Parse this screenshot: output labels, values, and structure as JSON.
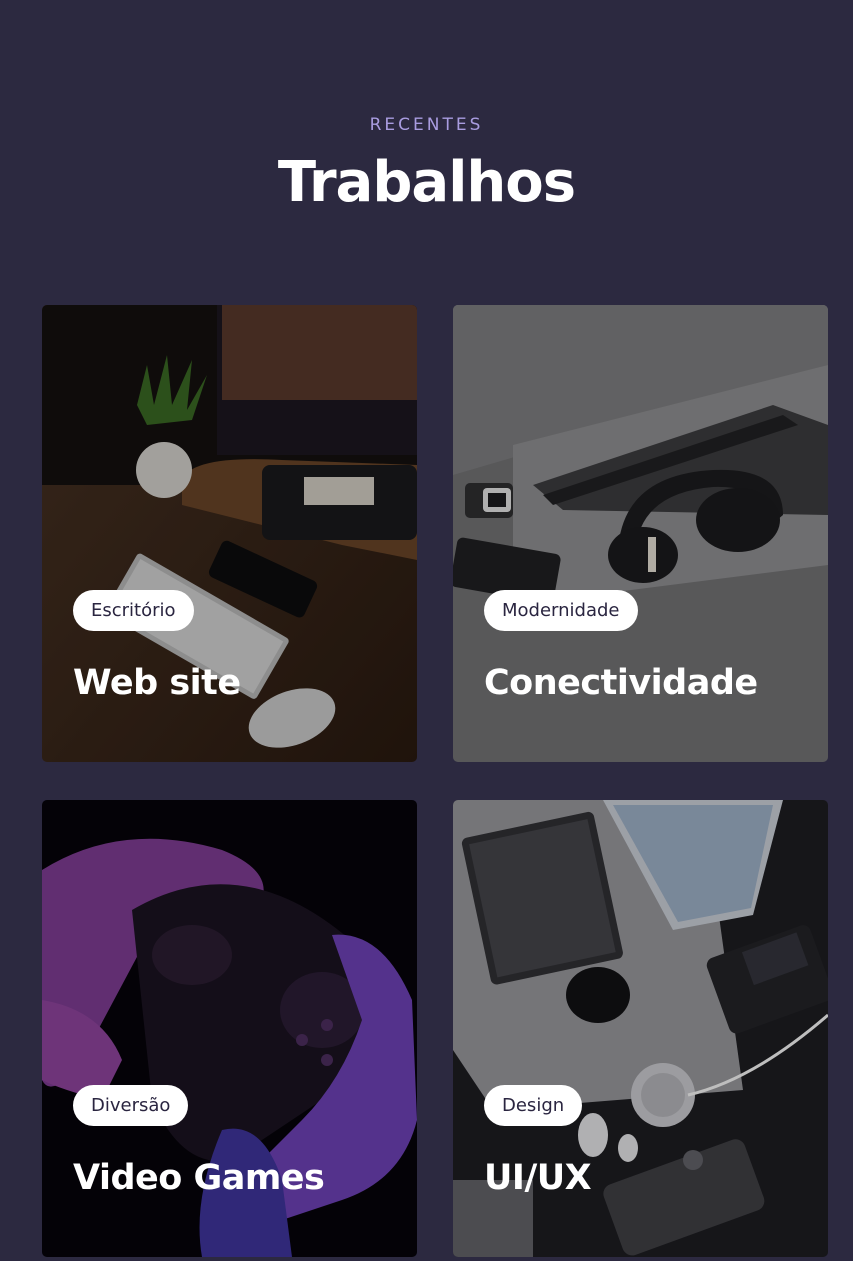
{
  "header": {
    "eyebrow": "RECENTES",
    "title": "Trabalhos"
  },
  "cards": [
    {
      "tag": "Escritório",
      "title": "Web site",
      "image": "desk-keyboard-mouse-photo"
    },
    {
      "tag": "Modernidade",
      "title": "Conectividade",
      "image": "headphones-laptop-photo"
    },
    {
      "tag": "Diversão",
      "title": "Video Games",
      "image": "game-controller-photo"
    },
    {
      "tag": "Design",
      "title": "UI/UX",
      "image": "desk-setup-photo"
    }
  ],
  "colors": {
    "background": "#2c2940",
    "eyebrow": "#a99ce0",
    "title": "#ffffff",
    "tag_bg": "#ffffff"
  }
}
